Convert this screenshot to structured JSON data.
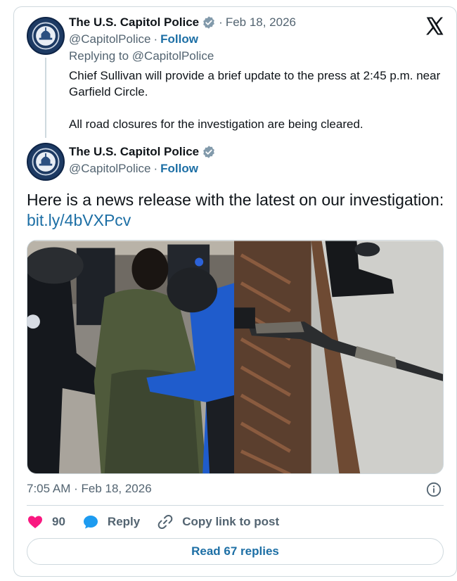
{
  "reply_tweet": {
    "author_name": "The U.S. Capitol Police",
    "separator": "·",
    "date": "Feb 18, 2026",
    "handle": "@CapitolPolice",
    "follow_label": "Follow",
    "replying_to_prefix": "Replying to",
    "replying_to_handle": "@CapitolPolice",
    "text_line1": "Chief Sullivan will provide a brief update to the press at 2:45 p.m. near",
    "text_line2": "Garfield Circle.",
    "text_line3": "All road closures for the investigation are being cleared."
  },
  "main_tweet": {
    "author_name": "The U.S. Capitol Police",
    "handle": "@CapitolPolice",
    "follow_label": "Follow",
    "text": "Here is a news release with the latest on our investigation:",
    "link": "bit.ly/4bVXPcv",
    "media_alt": [
      "officers-detaining-suspect-photo",
      "shotgun-on-storm-grate-photo"
    ],
    "timestamp": "7:05 AM · Feb 18, 2026"
  },
  "actions": {
    "like_count": "90",
    "reply_label": "Reply",
    "copy_label": "Copy link to post"
  },
  "read_replies_label": "Read 67 replies",
  "icons": {
    "platform": "x-logo-icon",
    "verified": "verified-badge-icon",
    "info": "info-icon",
    "like": "heart-icon",
    "reply": "speech-bubble-icon",
    "copy": "link-icon"
  },
  "colors": {
    "link": "#1d6fa5",
    "verified": "#829aab",
    "heart": "#f91880",
    "reply_bubble": "#1d9bf0",
    "muted": "#536471"
  }
}
